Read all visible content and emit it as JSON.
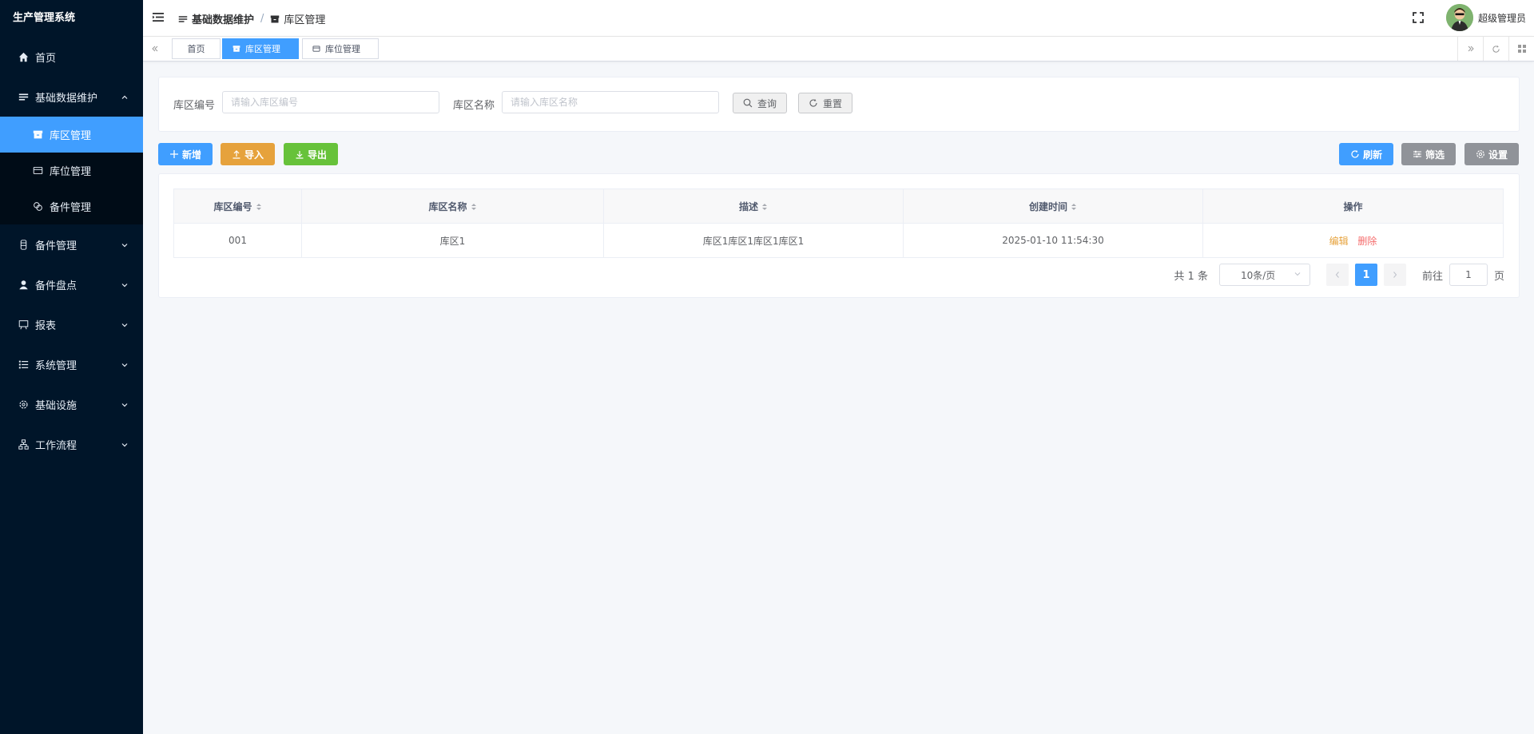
{
  "sidebar": {
    "title": "生产管理系统",
    "items": [
      {
        "label": "首页"
      },
      {
        "label": "基础数据维护"
      },
      {
        "label": "库区管理"
      },
      {
        "label": "库位管理"
      },
      {
        "label": "备件管理"
      },
      {
        "label": "备件管理"
      },
      {
        "label": "备件盘点"
      },
      {
        "label": "报表"
      },
      {
        "label": "系统管理"
      },
      {
        "label": "基础设施"
      },
      {
        "label": "工作流程"
      }
    ]
  },
  "header": {
    "breadcrumb": [
      "基础数据维护",
      "/",
      "库区管理"
    ],
    "username": "超级管理员"
  },
  "tags": [
    "首页",
    "库区管理",
    "库位管理"
  ],
  "search": {
    "code_label": "库区编号",
    "code_placeholder": "请输入库区编号",
    "name_label": "库区名称",
    "name_placeholder": "请输入库区名称",
    "query_label": "查询",
    "reset_label": "重置"
  },
  "toolbar": {
    "add": "新增",
    "import": "导入",
    "export": "导出",
    "refresh": "刷新",
    "filter": "筛选",
    "settings": "设置"
  },
  "table": {
    "columns": [
      "库区编号",
      "库区名称",
      "描述",
      "创建时间",
      "操作"
    ],
    "rows": [
      {
        "code": "001",
        "name": "库区1",
        "desc": "库区1库区1库区1库区1",
        "created": "2025-01-10 11:54:30",
        "edit": "编辑",
        "delete": "删除"
      }
    ]
  },
  "pagination": {
    "total": "共 1 条",
    "page_size": "10条/页",
    "current": "1",
    "goto_prefix": "前往",
    "goto_value": "1",
    "goto_suffix": "页"
  },
  "colors": {
    "sidebar_bg": "#001529",
    "primary": "#409eff",
    "warning": "#e6a23c",
    "success": "#67c23a",
    "danger": "#f56c6c",
    "info": "#909399"
  }
}
